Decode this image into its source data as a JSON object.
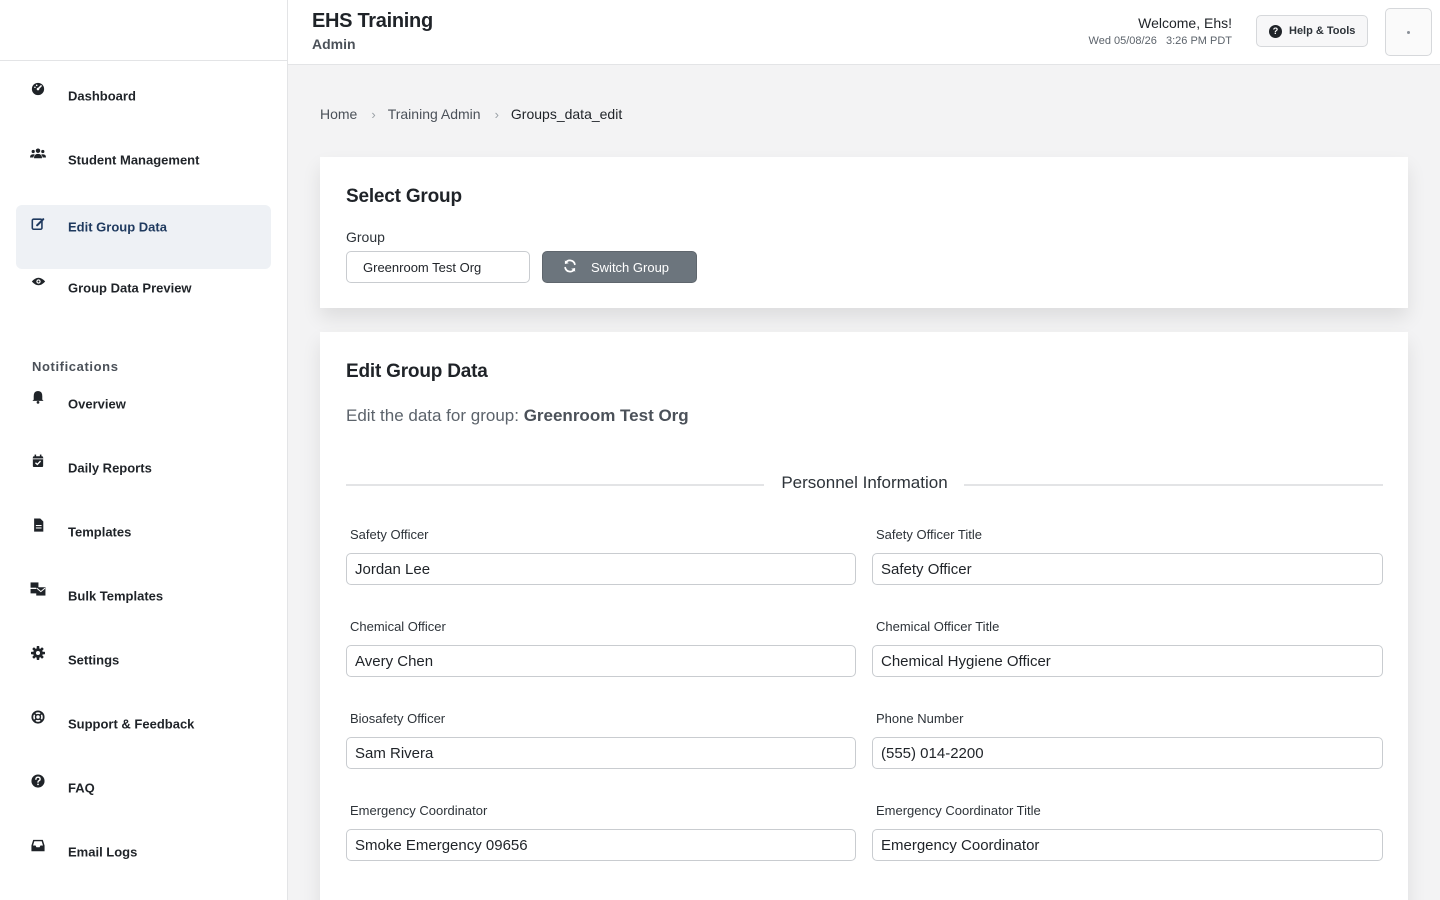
{
  "header": {
    "title": "EHS Training",
    "subtitle": "Admin",
    "welcome": "Welcome, Ehs!",
    "datetime": "Wed 05/08/26   3:26 PM PDT",
    "help_label": "Help & Tools"
  },
  "sidebar": {
    "items": [
      {
        "label": "Dashboard",
        "icon": "dashboard-icon"
      },
      {
        "label": "Student Management",
        "icon": "users-icon"
      },
      {
        "label": "Edit Group Data",
        "icon": "edit-icon",
        "active": true
      },
      {
        "label": "Group Data Preview",
        "icon": "eye-icon"
      }
    ],
    "section_title": "Notifications",
    "notification_items": [
      {
        "label": "Overview",
        "icon": "bell-icon"
      },
      {
        "label": "Daily Reports",
        "icon": "calendar-check-icon"
      },
      {
        "label": "Templates",
        "icon": "file-icon"
      },
      {
        "label": "Bulk Templates",
        "icon": "mail-bulk-icon"
      },
      {
        "label": "Settings",
        "icon": "gear-icon"
      },
      {
        "label": "Support & Feedback",
        "icon": "life-ring-icon"
      },
      {
        "label": "FAQ",
        "icon": "question-circle-icon"
      },
      {
        "label": "Email Logs",
        "icon": "inbox-icon"
      }
    ]
  },
  "breadcrumb": {
    "home": "Home",
    "parent": "Training Admin",
    "current": "Groups_data_edit",
    "separator": "›"
  },
  "select_group": {
    "title": "Select Group",
    "group_label": "Group",
    "group_value": "Greenroom Test Org",
    "switch_label": "Switch Group"
  },
  "edit_group": {
    "title": "Edit Group Data",
    "desc_prefix": "Edit the data for group:",
    "group_name": "Greenroom Test Org",
    "section_title": "Personnel Information",
    "fields": [
      {
        "label": "Safety Officer",
        "value": "Jordan Lee"
      },
      {
        "label": "Safety Officer Title",
        "value": "Safety Officer"
      },
      {
        "label": "Chemical Officer",
        "value": "Avery Chen"
      },
      {
        "label": "Chemical Officer Title",
        "value": "Chemical Hygiene Officer"
      },
      {
        "label": "Biosafety Officer",
        "value": "Sam Rivera"
      },
      {
        "label": "Phone Number",
        "value": "(555) 014-2200"
      },
      {
        "label": "Emergency Coordinator",
        "value": "Smoke Emergency 09656"
      },
      {
        "label": "Emergency Coordinator Title",
        "value": "Emergency Coordinator"
      }
    ]
  },
  "colors": {
    "active_bg": "#eef1f5",
    "switch_button": "#6c757d",
    "page_bg": "#f3f3f4"
  }
}
